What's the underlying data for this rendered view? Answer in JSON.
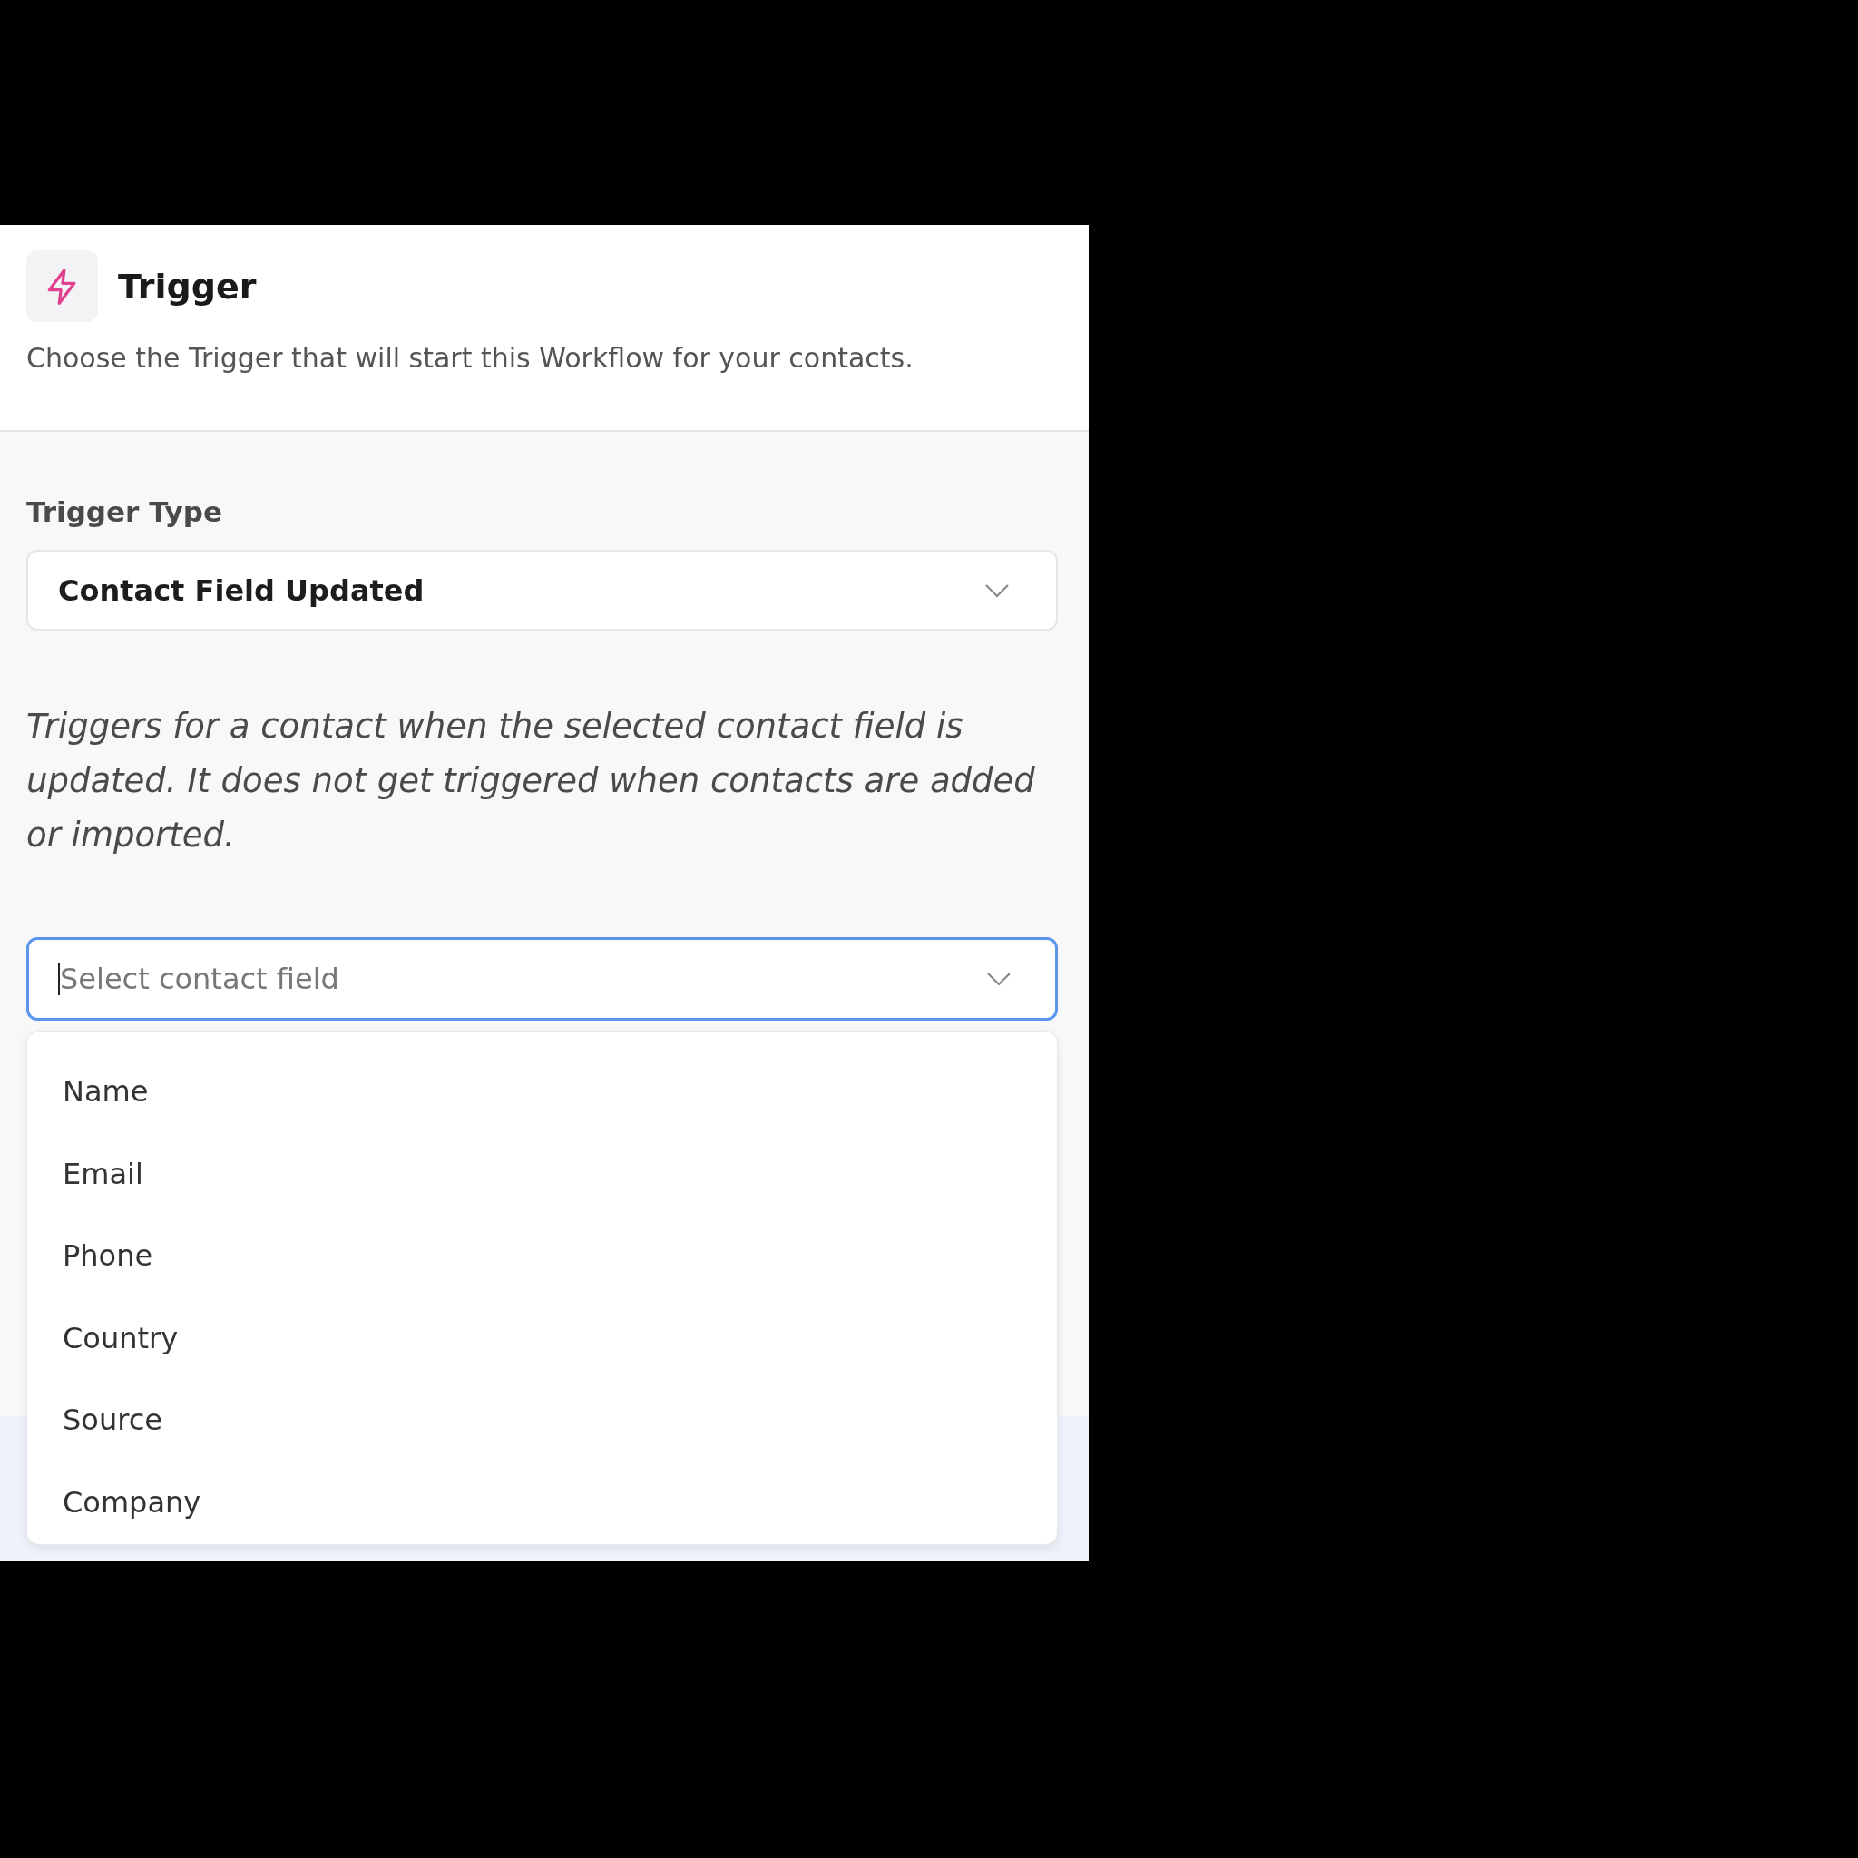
{
  "header": {
    "title": "Trigger",
    "subtitle": "Choose the Trigger that will start this Workflow for your contacts."
  },
  "trigger_type": {
    "label": "Trigger Type",
    "value": "Contact Field Updated"
  },
  "description": "Triggers for a contact when the selected contact field is updated. It does not get triggered when contacts are added or imported.",
  "contact_field": {
    "placeholder": "Select contact field",
    "expanded": true,
    "options": [
      {
        "label": "Name"
      },
      {
        "label": "Email"
      },
      {
        "label": "Phone"
      },
      {
        "label": "Country"
      },
      {
        "label": "Source"
      },
      {
        "label": "Company"
      }
    ]
  }
}
